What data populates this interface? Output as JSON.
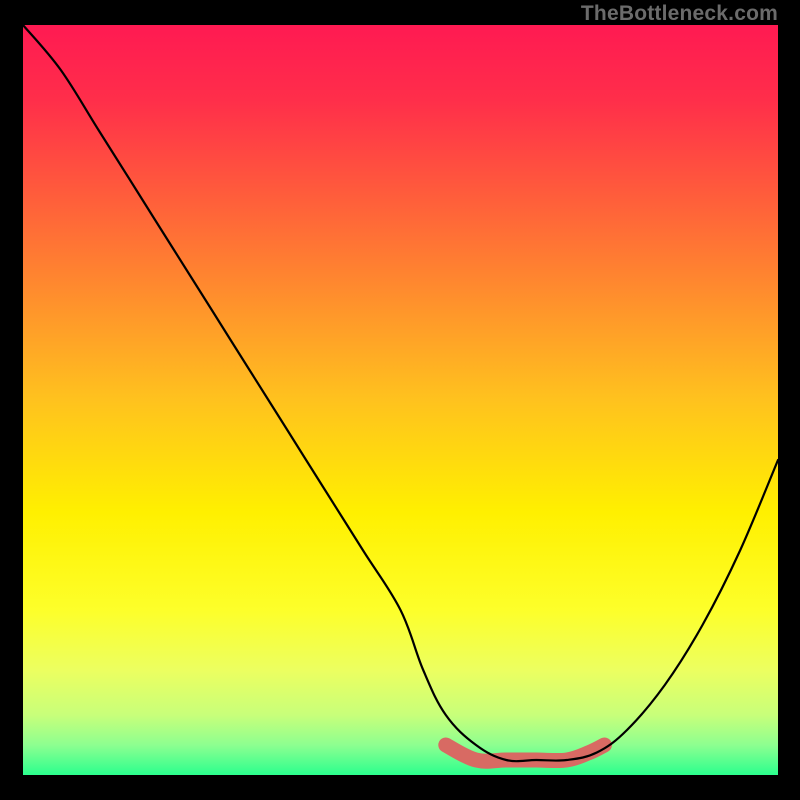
{
  "watermark": "TheBottleneck.com",
  "chart_data": {
    "type": "line",
    "title": "",
    "xlabel": "",
    "ylabel": "",
    "xlim": [
      0,
      100
    ],
    "ylim": [
      0,
      100
    ],
    "grid": false,
    "legend": false,
    "series": [
      {
        "name": "bottleneck-curve",
        "x": [
          0,
          5,
          10,
          15,
          20,
          25,
          30,
          35,
          40,
          45,
          50,
          53,
          56,
          60,
          64,
          68,
          72,
          76,
          80,
          85,
          90,
          95,
          100
        ],
        "y": [
          100,
          94,
          86,
          78,
          70,
          62,
          54,
          46,
          38,
          30,
          22,
          14,
          8,
          4,
          2,
          2,
          2,
          3,
          6,
          12,
          20,
          30,
          42
        ]
      },
      {
        "name": "optimum-highlight",
        "x": [
          56,
          60,
          64,
          68,
          72,
          75,
          77
        ],
        "y": [
          4,
          2,
          2,
          2,
          2,
          3,
          4
        ]
      }
    ],
    "gradient_stops": [
      {
        "pos": 0.0,
        "color": "#ff1a52"
      },
      {
        "pos": 0.1,
        "color": "#ff2e4a"
      },
      {
        "pos": 0.22,
        "color": "#ff5a3c"
      },
      {
        "pos": 0.35,
        "color": "#ff8a2e"
      },
      {
        "pos": 0.5,
        "color": "#ffc21e"
      },
      {
        "pos": 0.65,
        "color": "#fff000"
      },
      {
        "pos": 0.78,
        "color": "#fdff2a"
      },
      {
        "pos": 0.86,
        "color": "#ecff60"
      },
      {
        "pos": 0.92,
        "color": "#c8ff7a"
      },
      {
        "pos": 0.96,
        "color": "#8dff90"
      },
      {
        "pos": 1.0,
        "color": "#2bff8e"
      }
    ]
  }
}
